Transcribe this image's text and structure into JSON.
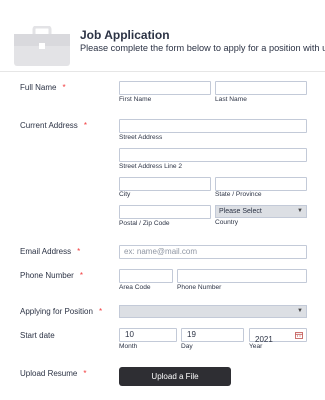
{
  "header": {
    "title": "Job Application",
    "subtitle": "Please complete the form below to apply for a position with us."
  },
  "fields": {
    "full_name": {
      "label": "Full Name",
      "required": "*",
      "first_label": "First Name",
      "last_label": "Last Name"
    },
    "address": {
      "label": "Current Address",
      "required": "*",
      "street_label": "Street Address",
      "street2_label": "Street Address Line 2",
      "city_label": "City",
      "state_label": "State / Province",
      "postal_label": "Postal / Zip Code",
      "country_label": "Country",
      "country_value": "Please Select"
    },
    "email": {
      "label": "Email Address",
      "required": "*",
      "placeholder": "ex: name@mail.com"
    },
    "phone": {
      "label": "Phone Number",
      "required": "*",
      "area_label": "Area Code",
      "number_label": "Phone Number"
    },
    "position": {
      "label": "Applying for Position",
      "required": "*",
      "value": ""
    },
    "start_date": {
      "label": "Start date",
      "month_value": "10",
      "day_value": "19",
      "year_value": "2021",
      "month_label": "Month",
      "day_label": "Day",
      "year_label": "Year"
    },
    "resume": {
      "label": "Upload Resume",
      "required": "*",
      "button_label": "Upload a File"
    }
  },
  "icons": {
    "briefcase": "briefcase-icon",
    "calendar": "calendar-icon",
    "dropdown": "chevron-down-icon"
  },
  "colors": {
    "required": "#f23a3c",
    "text": "#2c3345",
    "upload_button": "#2e2e33",
    "select_bg": "#dcdfe4"
  }
}
